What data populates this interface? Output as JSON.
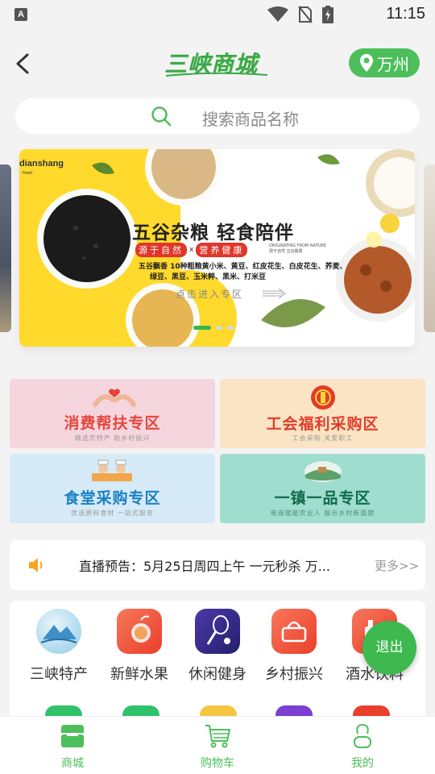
{
  "status_bar": {
    "time": "11:15",
    "app_indicator": "A"
  },
  "header": {
    "logo": "三峡商城",
    "location": "万州"
  },
  "search": {
    "placeholder": "搜索商品名称"
  },
  "banner": {
    "brand": "dianshang",
    "brand_sub": "fresh",
    "title": "五谷杂粮 轻食陪伴",
    "tag1": "源于自然",
    "tag_sep": "x",
    "tag2": "营养健康",
    "tagline_en": "ORIGINATING FROM NATURE",
    "tagline_cn": "源于自然 五谷飘香",
    "line1": "五谷飘香 10种粗粮黄小米、黄豆、红皮花生、白皮花生、荞麦、",
    "line2": "绿豆、黑豆、玉米粹、黑米、打米豆",
    "cta": "点击进入专区",
    "slides": 3,
    "active_slide": 1
  },
  "zones": [
    {
      "title": "消费帮扶专区",
      "subtitle": "精选农特产  助乡村振兴",
      "color": "#e6453c"
    },
    {
      "title": "工会福利采购区",
      "subtitle": "工会采购  关爱职工",
      "color": "#e23c2b"
    },
    {
      "title": "食堂采购专区",
      "subtitle": "优选原料食材  一站式服务",
      "color": "#1a7fc4"
    },
    {
      "title": "一镇一品专区",
      "subtitle": "电商赋能农业人  展示乡村新面貌",
      "color": "#0f6b4a"
    }
  ],
  "notice": {
    "text": "直播预告：5月25日周四上午 一元秒杀 万...",
    "more": "更多>>"
  },
  "categories": [
    {
      "label": "三峡特产",
      "icon": "mountain-icon",
      "color": "#3f8fc9"
    },
    {
      "label": "新鲜水果",
      "icon": "fruit-icon",
      "color": "#f2543c"
    },
    {
      "label": "休闲健身",
      "icon": "badminton-icon",
      "color": "#3a3190"
    },
    {
      "label": "乡村振兴",
      "icon": "basket-icon",
      "color": "#f2543c"
    },
    {
      "label": "酒水饮料",
      "icon": "bottle-icon",
      "color": "#f2543c"
    }
  ],
  "exit_button": "退出",
  "bottom_nav": [
    {
      "label": "商城",
      "icon": "shop-icon",
      "active": true
    },
    {
      "label": "购物车",
      "icon": "cart-icon",
      "active": false
    },
    {
      "label": "我的",
      "icon": "user-icon",
      "active": false
    }
  ],
  "colors": {
    "primary": "#4cbf5a",
    "banner_yellow": "#ffd92c"
  }
}
